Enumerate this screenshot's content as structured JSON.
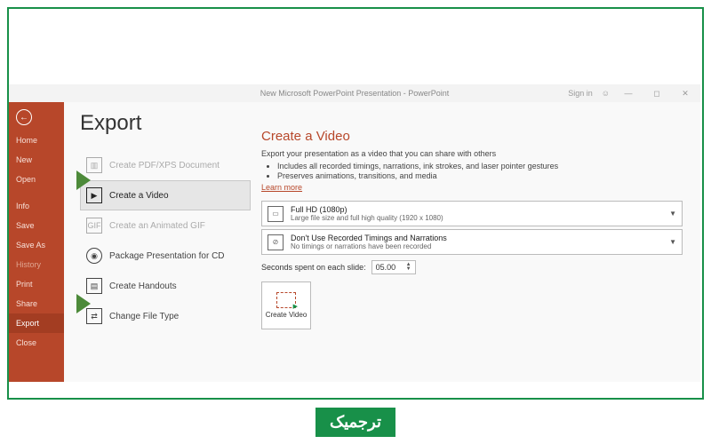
{
  "titlebar": {
    "title": "New Microsoft PowerPoint Presentation - PowerPoint",
    "signin": "Sign in"
  },
  "sidebar": {
    "items": [
      {
        "label": "Home"
      },
      {
        "label": "New"
      },
      {
        "label": "Open"
      },
      {
        "label": "Info"
      },
      {
        "label": "Save"
      },
      {
        "label": "Save As"
      },
      {
        "label": "History"
      },
      {
        "label": "Print"
      },
      {
        "label": "Share"
      },
      {
        "label": "Export"
      },
      {
        "label": "Close"
      }
    ]
  },
  "export": {
    "title": "Export",
    "items": [
      {
        "label": "Create PDF/XPS Document"
      },
      {
        "label": "Create a Video"
      },
      {
        "label": "Create an Animated GIF"
      },
      {
        "label": "Package Presentation for CD"
      },
      {
        "label": "Create Handouts"
      },
      {
        "label": "Change File Type"
      }
    ]
  },
  "video": {
    "heading": "Create a Video",
    "desc": "Export your presentation as a video that you can share with others",
    "bullet1": "Includes all recorded timings, narrations, ink strokes, and laser pointer gestures",
    "bullet2": "Preserves animations, transitions, and media",
    "learn": "Learn more",
    "quality": {
      "t1": "Full HD (1080p)",
      "t2": "Large file size and full high quality (1920 x 1080)"
    },
    "timings": {
      "t1": "Don't Use Recorded Timings and Narrations",
      "t2": "No timings or narrations have been recorded"
    },
    "seconds_label": "Seconds spent on each slide:",
    "seconds_value": "05.00",
    "create_btn": "Create Video"
  },
  "badge": "ترجمیک"
}
